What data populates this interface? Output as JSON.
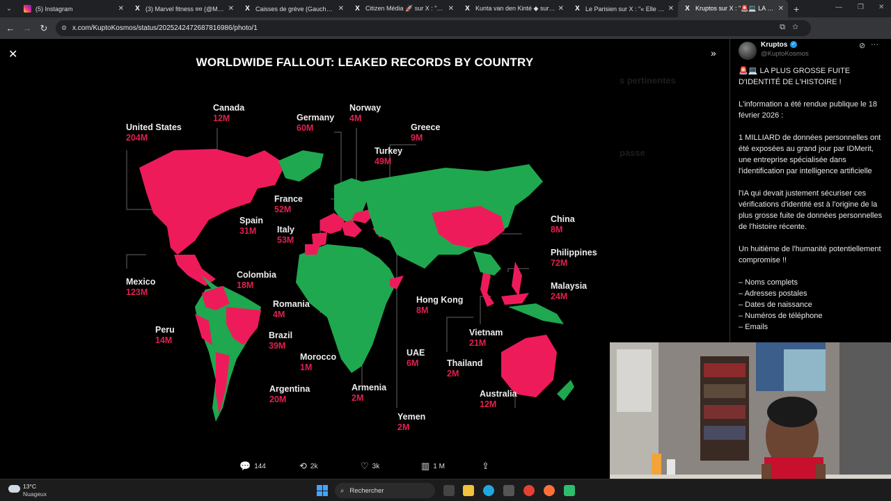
{
  "browser": {
    "tabs": [
      {
        "title": "(5) Instagram",
        "favicon": "instagram-icon",
        "active": false
      },
      {
        "title": "(3) Marvel fitness ¤¤ (@Marvel_",
        "favicon": "x-icon",
        "active": false
      },
      {
        "title": "Caisses de grève (Gauche Gaza",
        "favicon": "x-icon",
        "active": false
      },
      {
        "title": "Citizen Média 🚀 sur X : \"¤¤ 🇫",
        "favicon": "x-icon",
        "active": false
      },
      {
        "title": "Kunta van den Kinté ◆ sur X : \"",
        "favicon": "x-icon",
        "active": false
      },
      {
        "title": "Le Parisien sur X : \"« Elle m'a pr",
        "favicon": "x-icon",
        "active": false
      },
      {
        "title": "Kruptos sur X : \"🚨💻 LA PLUS",
        "favicon": "x-icon",
        "active": true
      }
    ],
    "url": "x.com/KuptoKosmos/status/2025242472687816986/photo/1"
  },
  "image": {
    "title": "WORLDWIDE FALLOUT: LEAKED RECORDS BY COUNTRY",
    "labels": [
      {
        "country": "United States",
        "value": "204M"
      },
      {
        "country": "Canada",
        "value": "12M"
      },
      {
        "country": "Germany",
        "value": "60M"
      },
      {
        "country": "Norway",
        "value": "4M"
      },
      {
        "country": "Greece",
        "value": "9M"
      },
      {
        "country": "Turkey",
        "value": "49M"
      },
      {
        "country": "France",
        "value": "52M"
      },
      {
        "country": "Spain",
        "value": "31M"
      },
      {
        "country": "Italy",
        "value": "53M"
      },
      {
        "country": "China",
        "value": "8M"
      },
      {
        "country": "Philippines",
        "value": "72M"
      },
      {
        "country": "Malaysia",
        "value": "24M"
      },
      {
        "country": "Mexico",
        "value": "123M"
      },
      {
        "country": "Colombia",
        "value": "18M"
      },
      {
        "country": "Romania",
        "value": "4M"
      },
      {
        "country": "Hong Kong",
        "value": "8M"
      },
      {
        "country": "Peru",
        "value": "14M"
      },
      {
        "country": "Brazil",
        "value": "39M"
      },
      {
        "country": "Vietnam",
        "value": "21M"
      },
      {
        "country": "Morocco",
        "value": "1M"
      },
      {
        "country": "UAE",
        "value": "6M"
      },
      {
        "country": "Thailand",
        "value": "2M"
      },
      {
        "country": "Armenia",
        "value": "2M"
      },
      {
        "country": "Argentina",
        "value": "20M"
      },
      {
        "country": "Australia",
        "value": "12M"
      },
      {
        "country": "Yemen",
        "value": "2M"
      }
    ],
    "colors": {
      "leaked": "#ee1b5b",
      "other": "#1fa84f",
      "value_text": "#e0204e"
    }
  },
  "actions": {
    "replies": "144",
    "reposts": "2k",
    "likes": "3k",
    "views": "1 M"
  },
  "tweet": {
    "author": "Kruptos",
    "handle": "@KuptoKosmos",
    "paragraphs": [
      "🚨💻 LA PLUS GROSSE FUITE D'IDENTITÉ DE L'HISTOIRE !",
      "L'information a été rendue publique le 18 février 2026 :",
      "1 MILLIARD de données personnelles ont été exposées au grand jour par IDMerit, une entreprise spécialisée dans l'identification par intelligence artificielle",
      "l'IA qui devait justement sécuriser ces vérifications d'identité est à l'origine de la plus grosse fuite de données personnelles de l'histoire récente.",
      "Un huitième de l'humanité potentiellement compromise !!"
    ],
    "list": [
      "– Noms complets",
      "– Adresses postales",
      "– Dates de naissance",
      "– Numéros de téléphone",
      "– Emails"
    ]
  },
  "underlay": {
    "heading1": "s pertinentes",
    "heading2": "passe"
  },
  "taskbar": {
    "temperature": "13°C",
    "weather": "Nuageux",
    "search_placeholder": "Rechercher"
  }
}
